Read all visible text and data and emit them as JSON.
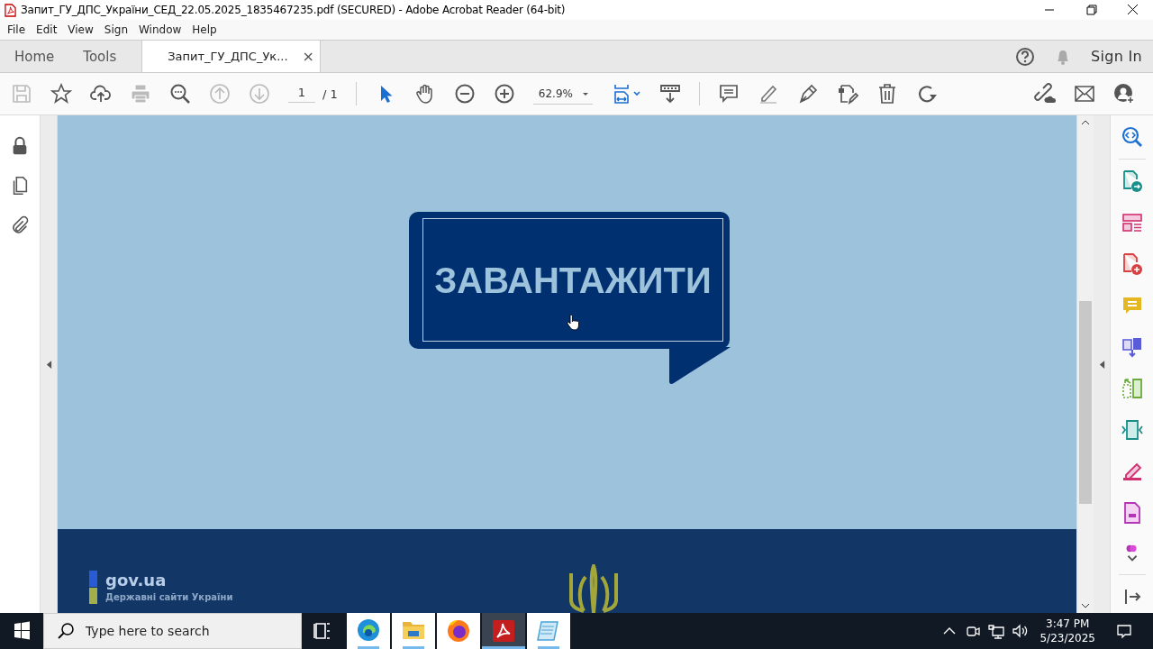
{
  "window": {
    "title": "Запит_ГУ_ДПС_України_СЕД_22.05.2025_1835467235.pdf (SECURED) - Adobe Acrobat Reader (64-bit)"
  },
  "menu": [
    "File",
    "Edit",
    "View",
    "Sign",
    "Window",
    "Help"
  ],
  "tabs": [
    {
      "label": "Home",
      "selected": false
    },
    {
      "label": "Tools",
      "selected": false
    },
    {
      "label": "Запит_ГУ_ДПС_Ук...",
      "selected": true,
      "close_label": "×"
    }
  ],
  "sign_in": "Sign In",
  "toolbar": {
    "page": "1",
    "page_total": "/ 1",
    "zoom": "62.9%"
  },
  "document": {
    "button_text": "ЗАВАНТАЖИТИ",
    "footer_logo": "gov.ua",
    "footer_subtitle": "Державні сайти України"
  },
  "taskbar": {
    "search_placeholder": "Type here to search",
    "time": "3:47 PM",
    "date": "5/23/2025"
  }
}
